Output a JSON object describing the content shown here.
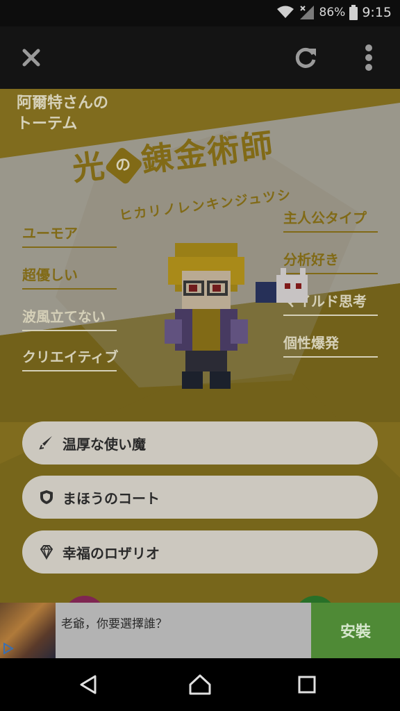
{
  "status_bar": {
    "battery": "86%",
    "time": "9:15"
  },
  "header": {
    "owner_line1": "阿爾特さんの",
    "owner_line2": "トーテム"
  },
  "title": {
    "part1": "光",
    "connector": "の",
    "part2": "錬金術師",
    "reading": "ヒカリノレンキンジュツシ"
  },
  "traits_left": [
    "ユーモア",
    "超優しい",
    "波風立てない",
    "クリエイティブ"
  ],
  "traits_right": [
    "主人公タイプ",
    "分析好き",
    "マイルド思考",
    "個性爆発"
  ],
  "items": [
    {
      "icon": "sword-icon",
      "label": "温厚な使い魔"
    },
    {
      "icon": "shield-icon",
      "label": "まほうのコート"
    },
    {
      "icon": "diamond-icon",
      "label": "幸福のロザリオ"
    }
  ],
  "ad": {
    "text": "老爺，你要選擇誰？",
    "button": "安裝"
  },
  "colors": {
    "gold": "#8c7418",
    "cream": "#e8e2c8",
    "overlay_dim": "rgba(0,0,0,0.45)"
  }
}
